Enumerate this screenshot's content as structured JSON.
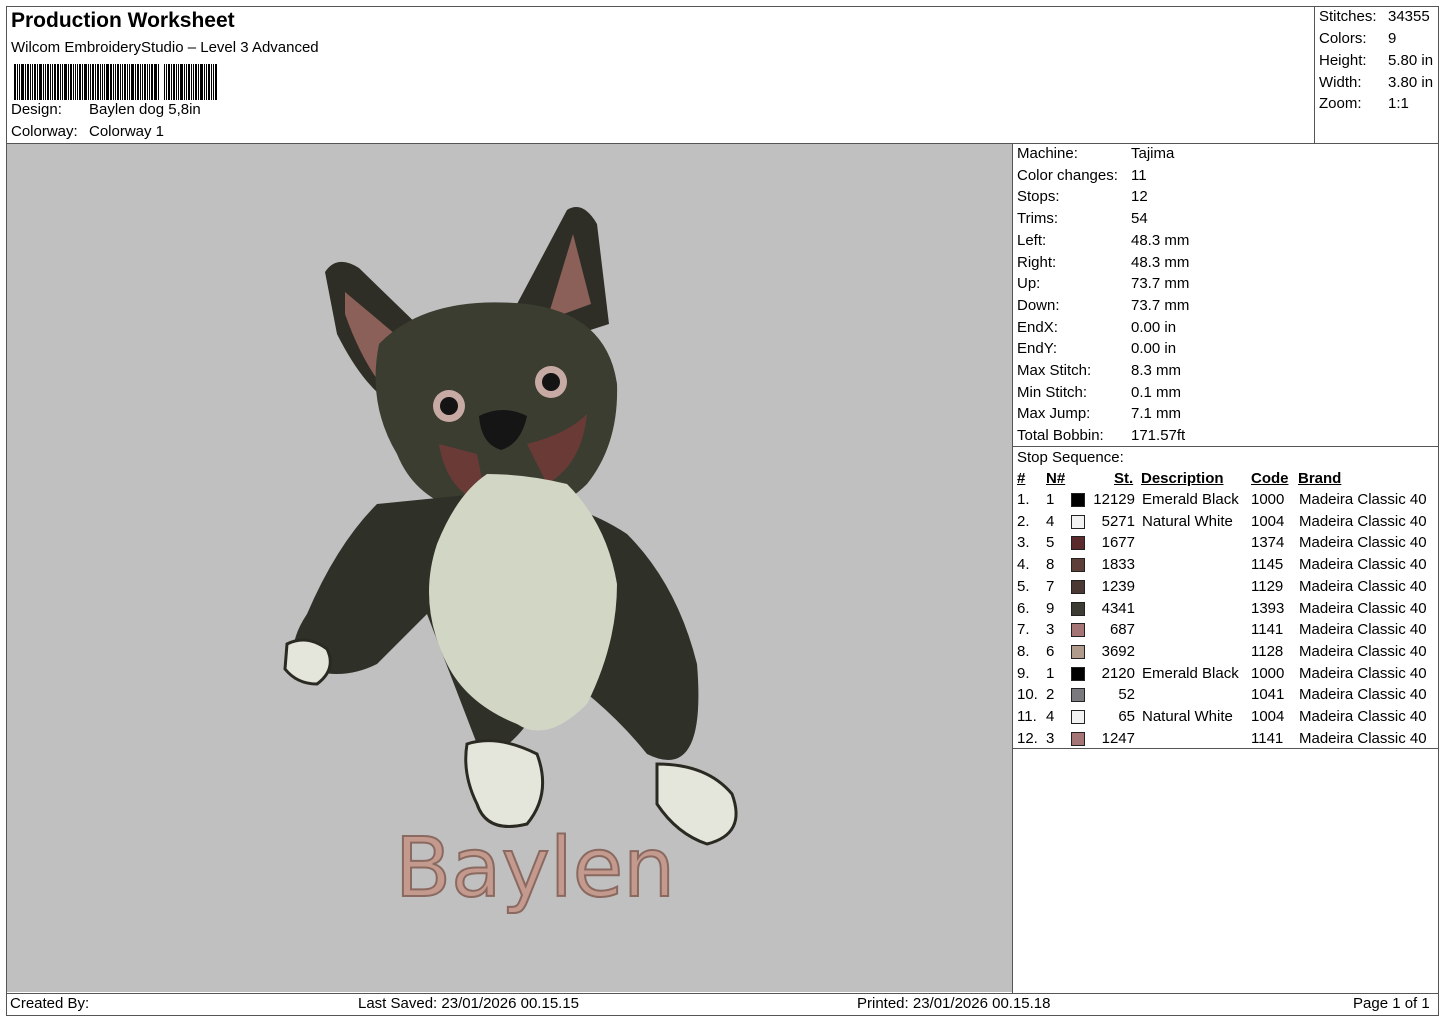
{
  "header": {
    "title": "Production Worksheet",
    "subtitle": "Wilcom EmbroideryStudio – Level 3 Advanced",
    "design_label": "Design:",
    "design_value": "Baylen dog 5,8in",
    "colorway_label": "Colorway:",
    "colorway_value": "Colorway 1"
  },
  "summary": {
    "stitches_label": "Stitches:",
    "stitches_value": "34355",
    "colors_label": "Colors:",
    "colors_value": "9",
    "height_label": "Height:",
    "height_value": "5.80 in",
    "width_label": "Width:",
    "width_value": "3.80 in",
    "zoom_label": "Zoom:",
    "zoom_value": "1:1"
  },
  "design": {
    "embroidered_text": "Baylen",
    "text_color": "#c49a8e",
    "background_color": "#c0c0c0"
  },
  "properties": [
    {
      "label": "Machine:",
      "value": "Tajima"
    },
    {
      "label": "Color changes:",
      "value": "11"
    },
    {
      "label": "Stops:",
      "value": "12"
    },
    {
      "label": "Trims:",
      "value": "54"
    },
    {
      "label": "Left:",
      "value": "48.3 mm"
    },
    {
      "label": "Right:",
      "value": "48.3 mm"
    },
    {
      "label": "Up:",
      "value": "73.7 mm"
    },
    {
      "label": "Down:",
      "value": "73.7 mm"
    },
    {
      "label": "EndX:",
      "value": "0.00 in"
    },
    {
      "label": "EndY:",
      "value": "0.00 in"
    },
    {
      "label": "Max Stitch:",
      "value": "8.3 mm"
    },
    {
      "label": "Min Stitch:",
      "value": "0.1 mm"
    },
    {
      "label": "Max Jump:",
      "value": "7.1 mm"
    },
    {
      "label": "Total Bobbin:",
      "value": "171.57ft"
    }
  ],
  "stop_sequence": {
    "caption": "Stop Sequence:",
    "columns": {
      "idx": "#",
      "needle": "N#",
      "stitches": "St.",
      "description": "Description",
      "code": "Code",
      "brand": "Brand"
    },
    "rows": [
      {
        "idx": "1.",
        "needle": "1",
        "color": "#000000",
        "stitches": "12129",
        "description": "Emerald Black",
        "code": "1000",
        "brand": "Madeira Classic 40"
      },
      {
        "idx": "2.",
        "needle": "4",
        "color": "#f2f2f2",
        "stitches": "5271",
        "description": "Natural White",
        "code": "1004",
        "brand": "Madeira Classic 40"
      },
      {
        "idx": "3.",
        "needle": "5",
        "color": "#5a2a2c",
        "stitches": "1677",
        "description": "",
        "code": "1374",
        "brand": "Madeira Classic 40"
      },
      {
        "idx": "4.",
        "needle": "8",
        "color": "#5e3e38",
        "stitches": "1833",
        "description": "",
        "code": "1145",
        "brand": "Madeira Classic 40"
      },
      {
        "idx": "5.",
        "needle": "7",
        "color": "#4a3834",
        "stitches": "1239",
        "description": "",
        "code": "1129",
        "brand": "Madeira Classic 40"
      },
      {
        "idx": "6.",
        "needle": "9",
        "color": "#3c3c34",
        "stitches": "4341",
        "description": "",
        "code": "1393",
        "brand": "Madeira Classic 40"
      },
      {
        "idx": "7.",
        "needle": "3",
        "color": "#a57474",
        "stitches": "687",
        "description": "",
        "code": "1141",
        "brand": "Madeira Classic 40"
      },
      {
        "idx": "8.",
        "needle": "6",
        "color": "#b09a8c",
        "stitches": "3692",
        "description": "",
        "code": "1128",
        "brand": "Madeira Classic 40"
      },
      {
        "idx": "9.",
        "needle": "1",
        "color": "#000000",
        "stitches": "2120",
        "description": "Emerald Black",
        "code": "1000",
        "brand": "Madeira Classic 40"
      },
      {
        "idx": "10.",
        "needle": "2",
        "color": "#7a7a7e",
        "stitches": "52",
        "description": "",
        "code": "1041",
        "brand": "Madeira Classic 40"
      },
      {
        "idx": "11.",
        "needle": "4",
        "color": "#f2f2f2",
        "stitches": "65",
        "description": "Natural White",
        "code": "1004",
        "brand": "Madeira Classic 40"
      },
      {
        "idx": "12.",
        "needle": "3",
        "color": "#a57474",
        "stitches": "1247",
        "description": "",
        "code": "1141",
        "brand": "Madeira Classic 40"
      }
    ]
  },
  "footer": {
    "created_by": "Created By:",
    "last_saved": "Last Saved: 23/01/2026 00.15.15",
    "printed": "Printed: 23/01/2026 00.15.18",
    "page": "Page 1 of 1"
  }
}
